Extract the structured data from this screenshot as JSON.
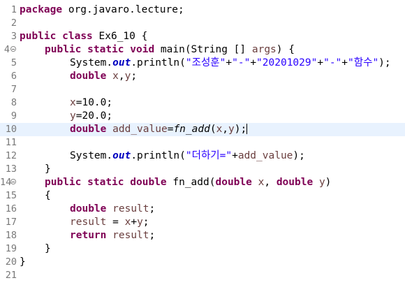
{
  "editor": {
    "line_numbers": [
      "1",
      "2",
      "3",
      "4",
      "5",
      "6",
      "7",
      "8",
      "9",
      "10",
      "11",
      "12",
      "13",
      "14",
      "15",
      "16",
      "17",
      "18",
      "19",
      "20",
      "21"
    ],
    "tokens": {
      "package_kw": "package",
      "package_name": " org.javaro.lecture;",
      "public_kw": "public",
      "class_kw": "class",
      "class_name": " Ex6_10 {",
      "static_kw": "static",
      "void_kw": "void",
      "main_sig_1": " main(String [] ",
      "args": "args",
      "main_sig_2": ") {",
      "system": "System.",
      "out": "out",
      "println_open": ".println(",
      "str_name": "\"조성훈\"",
      "plus": "+",
      "str_dash": "\"-\"",
      "str_date": "\"20201029\"",
      "str_func": "\"함수\"",
      "close_stmt": ");",
      "double_kw": "double",
      "x": "x",
      "comma": ",",
      "y": "y",
      "semicolon": ";",
      "x_assign": "x",
      "x_value": "=10.0;",
      "y_assign": "y",
      "y_value": "=20.0;",
      "add_value": "add_value",
      "equals": "=",
      "fn_add_call": "fn_add",
      "open_paren": "(",
      "close_paren": ")",
      "str_sum": "\"더하기=\"",
      "close_brace": "}",
      "fn_add_name": " fn_add(",
      "param_sep": ", ",
      "open_brace": "{",
      "result": "result",
      "return_kw": "return"
    }
  }
}
